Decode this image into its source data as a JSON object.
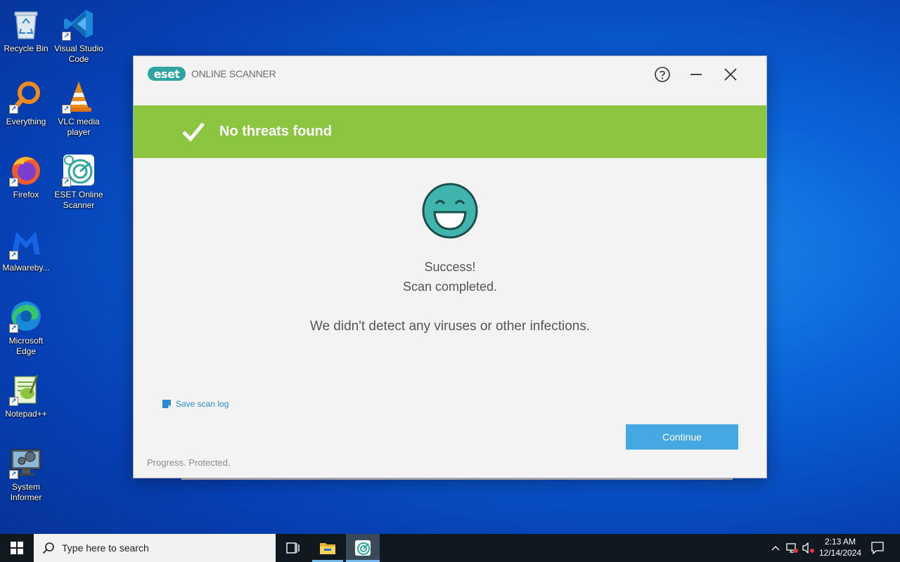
{
  "desktop": {
    "icons": [
      {
        "label": "Recycle Bin"
      },
      {
        "label": "Visual Studio Code"
      },
      {
        "label": "Everything"
      },
      {
        "label": "VLC media player"
      },
      {
        "label": "Firefox"
      },
      {
        "label": "ESET Online Scanner"
      },
      {
        "label": "Malwareby..."
      },
      {
        "label": "Microsoft Edge"
      },
      {
        "label": "Notepad++"
      },
      {
        "label": "System Informer"
      }
    ]
  },
  "eset": {
    "logo_text": "eset",
    "product_name": "ONLINE SCANNER",
    "banner_title": "No threats found",
    "success_line": "Success!",
    "completed_line": "Scan completed.",
    "detail_line": "We didn't detect any viruses or other infections.",
    "save_log_label": "Save scan log",
    "continue_label": "Continue",
    "tagline": "Progress. Protected.",
    "colors": {
      "banner": "#8cc540",
      "brand": "#2ea5a0",
      "continue": "#45a8e2",
      "smiley": "#3fb5ad"
    }
  },
  "taskbar": {
    "search_placeholder": "Type here to search",
    "clock_time": "2:13 AM",
    "clock_date": "12/14/2024"
  }
}
